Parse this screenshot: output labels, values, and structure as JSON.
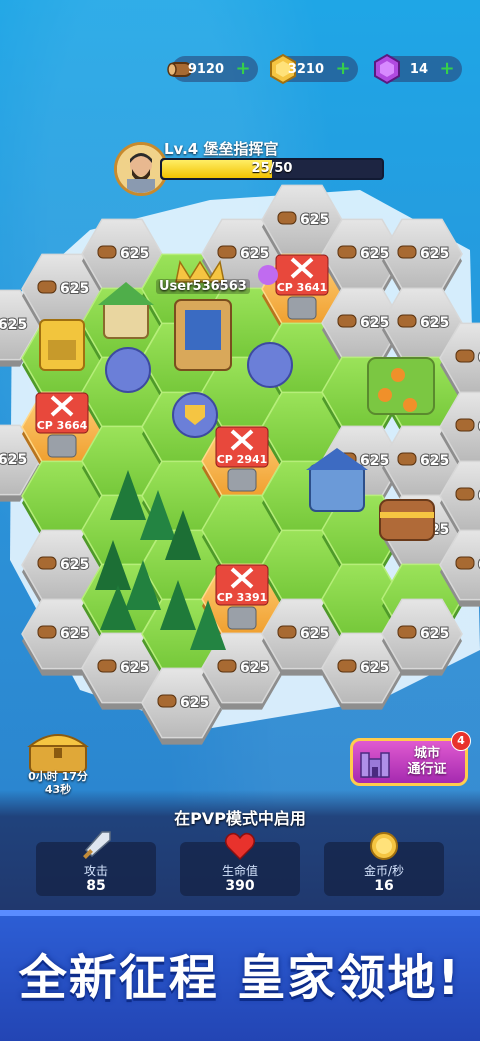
{
  "resources": {
    "wood": "9120",
    "gold": "3210",
    "gems": "14"
  },
  "player": {
    "title": "Lv.4 堡垒指挥官",
    "xp": "25/50",
    "xp_fraction": 0.5,
    "username": "User536563"
  },
  "tiles": {
    "cost_label": "625",
    "enemy_cp": [
      "CP 3641",
      "CP 2941",
      "CP 3664",
      "CP 3391"
    ]
  },
  "chest": {
    "timer_line1": "0小时 17分",
    "timer_line2": "43秒"
  },
  "city_pass": {
    "label_line1": "城市",
    "label_line2": "通行证",
    "badge": "4"
  },
  "pvp_notice": "在PVP模式中启用",
  "stats": [
    {
      "label": "攻击",
      "value": "85",
      "icon": "sword-icon"
    },
    {
      "label": "生命值",
      "value": "390",
      "icon": "heart-icon"
    },
    {
      "label": "金币/秒",
      "value": "16",
      "icon": "coin-icon"
    }
  ],
  "banner": "全新征程 皇家领地!",
  "colors": {
    "sea": "#2a9ed8",
    "grass": "#8bdc4a",
    "stone_tile": "#c9c9c9",
    "enemy_tile": "#f4b042",
    "banner": "#2d5fd6",
    "accent_gold": "#f2c200"
  }
}
